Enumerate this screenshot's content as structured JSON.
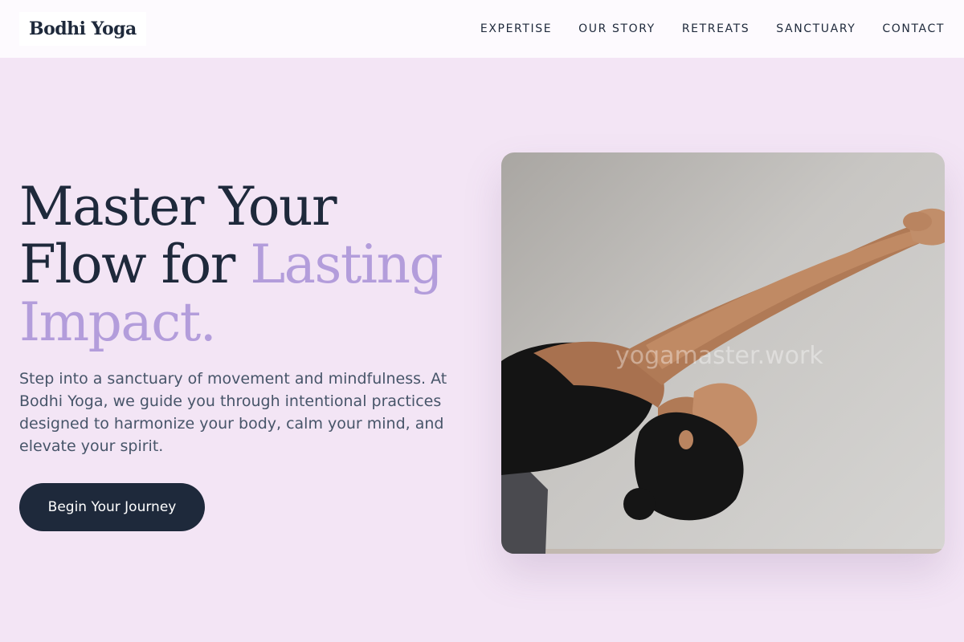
{
  "header": {
    "logo": "Bodhi Yoga",
    "nav": [
      "EXPERTISE",
      "OUR STORY",
      "RETREATS",
      "SANCTUARY",
      "CONTACT"
    ]
  },
  "hero": {
    "title_part1": "Master Your Flow for ",
    "title_accent": "Lasting Impact.",
    "description": "Step into a sanctuary of movement and mindfulness. At Bodhi Yoga, we guide you through intentional practices designed to harmonize your body, calm your mind, and elevate your spirit.",
    "cta_label": "Begin Your Journey",
    "image_watermark": "yogamaster.work"
  },
  "colors": {
    "background": "#f3e5f5",
    "header_bg": "#fdfafe",
    "dark": "#1e293b",
    "accent": "#b39ddb",
    "body_text": "#475569"
  }
}
